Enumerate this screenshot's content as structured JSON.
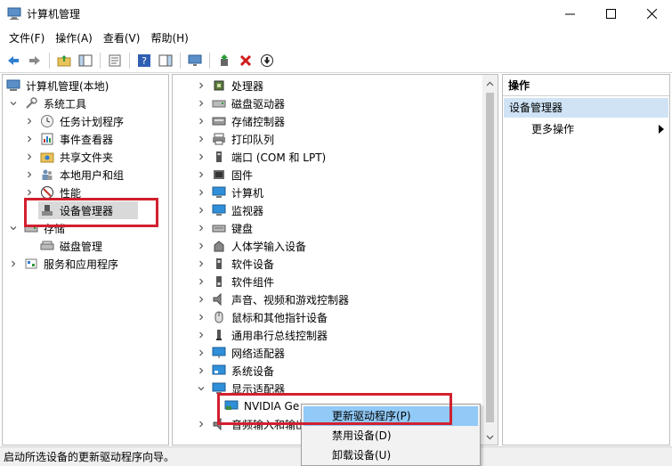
{
  "window": {
    "title": "计算机管理"
  },
  "menu": [
    "文件(F)",
    "操作(A)",
    "查看(V)",
    "帮助(H)"
  ],
  "left_tree": {
    "root": "计算机管理(本地)",
    "items": [
      {
        "label": "系统工具",
        "icon": "tools-icon"
      },
      {
        "label": "任务计划程序",
        "icon": "clock-icon"
      },
      {
        "label": "事件查看器",
        "icon": "event-viewer-icon"
      },
      {
        "label": "共享文件夹",
        "icon": "shared-folder-icon"
      },
      {
        "label": "本地用户和组",
        "icon": "users-icon"
      },
      {
        "label": "性能",
        "icon": "performance-icon"
      },
      {
        "label": "设备管理器",
        "icon": "device-manager-icon"
      },
      {
        "label": "存储",
        "icon": "storage-icon"
      },
      {
        "label": "磁盘管理",
        "icon": "disk-icon"
      },
      {
        "label": "服务和应用程序",
        "icon": "services-icon"
      }
    ]
  },
  "device_tree": {
    "items": [
      {
        "label": "处理器",
        "icon": "processor-icon"
      },
      {
        "label": "磁盘驱动器",
        "icon": "disk-drive-icon"
      },
      {
        "label": "存储控制器",
        "icon": "storage-controller-icon"
      },
      {
        "label": "打印队列",
        "icon": "printer-icon"
      },
      {
        "label": "端口 (COM 和 LPT)",
        "icon": "port-icon"
      },
      {
        "label": "固件",
        "icon": "firmware-icon"
      },
      {
        "label": "计算机",
        "icon": "computer-icon"
      },
      {
        "label": "监视器",
        "icon": "monitor-icon"
      },
      {
        "label": "键盘",
        "icon": "keyboard-icon"
      },
      {
        "label": "人体学输入设备",
        "icon": "hid-icon"
      },
      {
        "label": "软件设备",
        "icon": "software-device-icon"
      },
      {
        "label": "软件组件",
        "icon": "software-component-icon"
      },
      {
        "label": "声音、视频和游戏控制器",
        "icon": "sound-icon"
      },
      {
        "label": "鼠标和其他指针设备",
        "icon": "mouse-icon"
      },
      {
        "label": "通用串行总线控制器",
        "icon": "usb-icon"
      },
      {
        "label": "网络适配器",
        "icon": "network-icon"
      },
      {
        "label": "系统设备",
        "icon": "system-device-icon"
      },
      {
        "label": "显示适配器",
        "icon": "display-adapter-icon"
      },
      {
        "label": "NVIDIA Ge",
        "icon": "gpu-icon"
      },
      {
        "label": "音频输入和输出",
        "icon": "audio-icon"
      }
    ]
  },
  "actions": {
    "header": "操作",
    "section": "设备管理器",
    "more": "更多操作"
  },
  "context_menu": {
    "items": [
      "更新驱动程序(P)",
      "禁用设备(D)",
      "卸载设备(U)"
    ]
  },
  "status": "启动所选设备的更新驱动程序向导。",
  "colors": {
    "highlight": "#d2202f",
    "selection": "#91c9f7",
    "action_section": "#cfe3f5"
  }
}
